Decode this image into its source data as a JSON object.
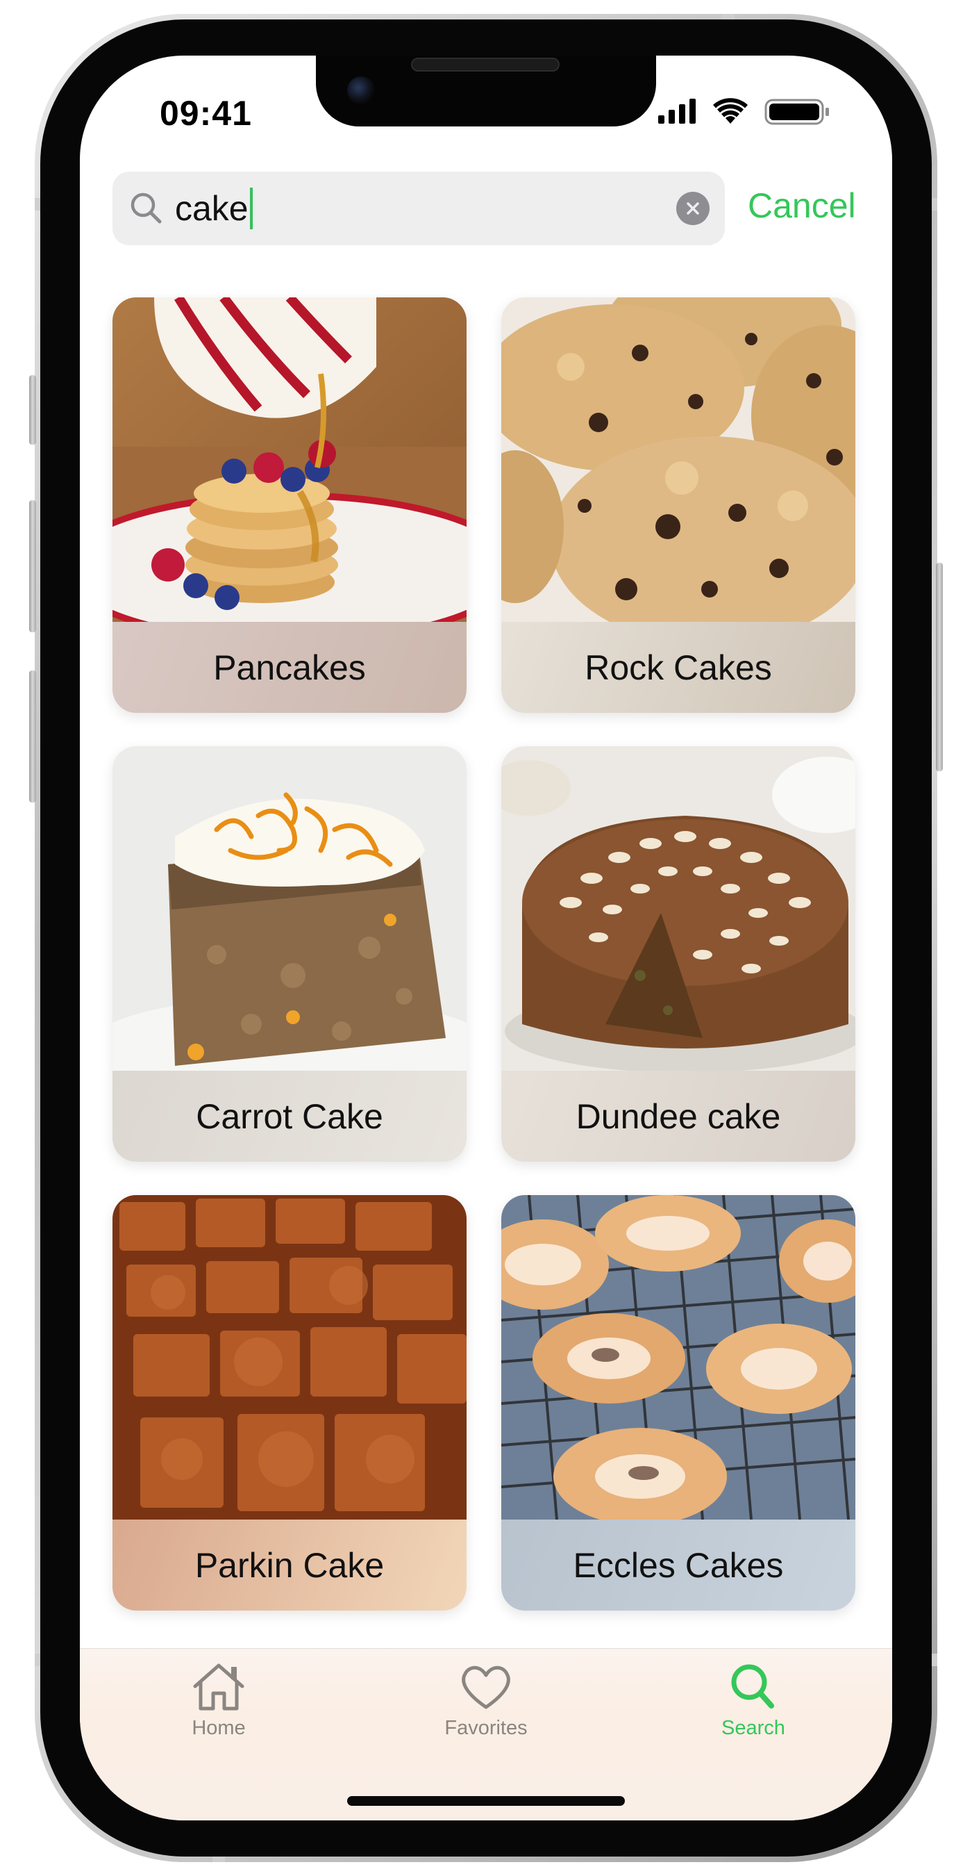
{
  "status_bar": {
    "time": "09:41",
    "icons": [
      "cellular-signal-icon",
      "wifi-icon",
      "battery-icon"
    ]
  },
  "search": {
    "query": "cake",
    "icon": "magnifier-icon",
    "clear_icon": "clear-circle-icon",
    "cancel_label": "Cancel"
  },
  "results": [
    {
      "title": "Pancakes",
      "image": "pancakes-photo",
      "tint": [
        "#d9c8c4",
        "#cbb7ac"
      ]
    },
    {
      "title": "Rock Cakes",
      "image": "rock-cakes-photo",
      "tint": [
        "#e7e1d8",
        "#cfc4b6"
      ]
    },
    {
      "title": "Carrot Cake",
      "image": "carrot-cake-photo",
      "tint": [
        "#dcd8d1",
        "#e8e4de"
      ]
    },
    {
      "title": "Dundee cake",
      "image": "dundee-cake-photo",
      "tint": [
        "#e7e1da",
        "#d8d0c8"
      ]
    },
    {
      "title": "Parkin Cake",
      "image": "parkin-cake-photo",
      "tint": [
        "#d9a98f",
        "#f2d6b8"
      ]
    },
    {
      "title": "Eccles Cakes",
      "image": "eccles-cakes-photo",
      "tint": [
        "#b9c3ce",
        "#c9d3dd"
      ]
    }
  ],
  "tabbar": {
    "tabs": [
      {
        "label": "Home",
        "icon": "house-icon",
        "active": false
      },
      {
        "label": "Favorites",
        "icon": "heart-icon",
        "active": false
      },
      {
        "label": "Search",
        "icon": "search-icon",
        "active": true
      }
    ]
  },
  "colors": {
    "accent": "#34c759",
    "inactive_tab": "#8a8580",
    "text": "#111111"
  }
}
